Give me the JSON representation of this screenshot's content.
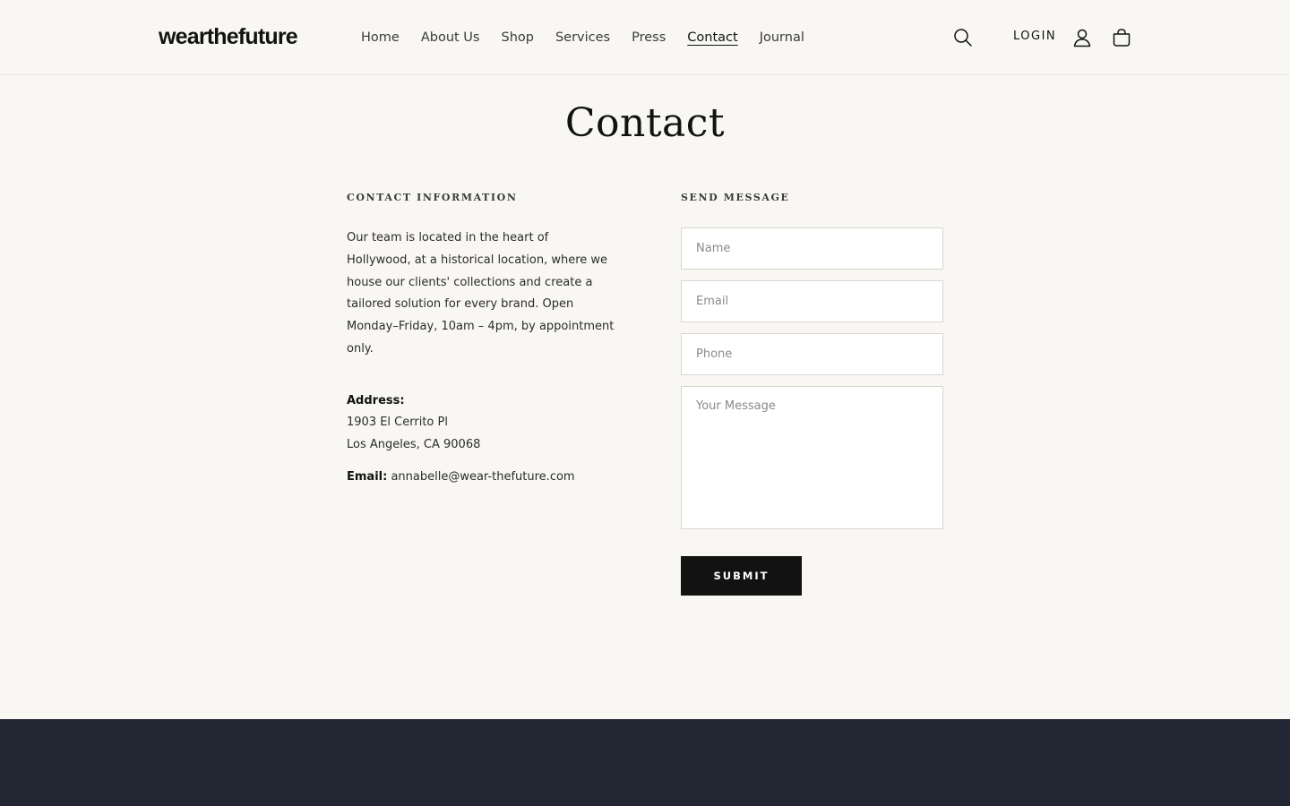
{
  "header": {
    "logo": "wearthefuture",
    "nav": [
      "Home",
      "About Us",
      "Shop",
      "Services",
      "Press",
      "Contact",
      "Journal"
    ],
    "active_nav": "Contact",
    "login_label": "LOGIN",
    "icons": [
      "search-icon",
      "account-icon",
      "cart-icon"
    ]
  },
  "page": {
    "title": "Contact"
  },
  "contact_info": {
    "heading": "CONTACT INFORMATION",
    "description": "Our team is located in the heart of Hollywood, at a historical location, where we house our clients' collections and create a tailored solution for every brand. Open Monday–Friday, 10am – 4pm, by appointment only.",
    "address_label": "Address:",
    "address_line1": "1903 El Cerrito Pl",
    "address_line2": "Los Angeles, CA 90068",
    "email_label": "Email:",
    "email": "annabelle@wear-thefuture.com"
  },
  "form": {
    "heading": "SEND MESSAGE",
    "name_placeholder": "Name",
    "email_placeholder": "Email",
    "phone_placeholder": "Phone",
    "message_placeholder": "Your Message",
    "submit_label": "SUBMIT"
  },
  "colors": {
    "background": "#f8f7f3",
    "text": "#121212",
    "button": "#121212",
    "footer": "#232733"
  }
}
